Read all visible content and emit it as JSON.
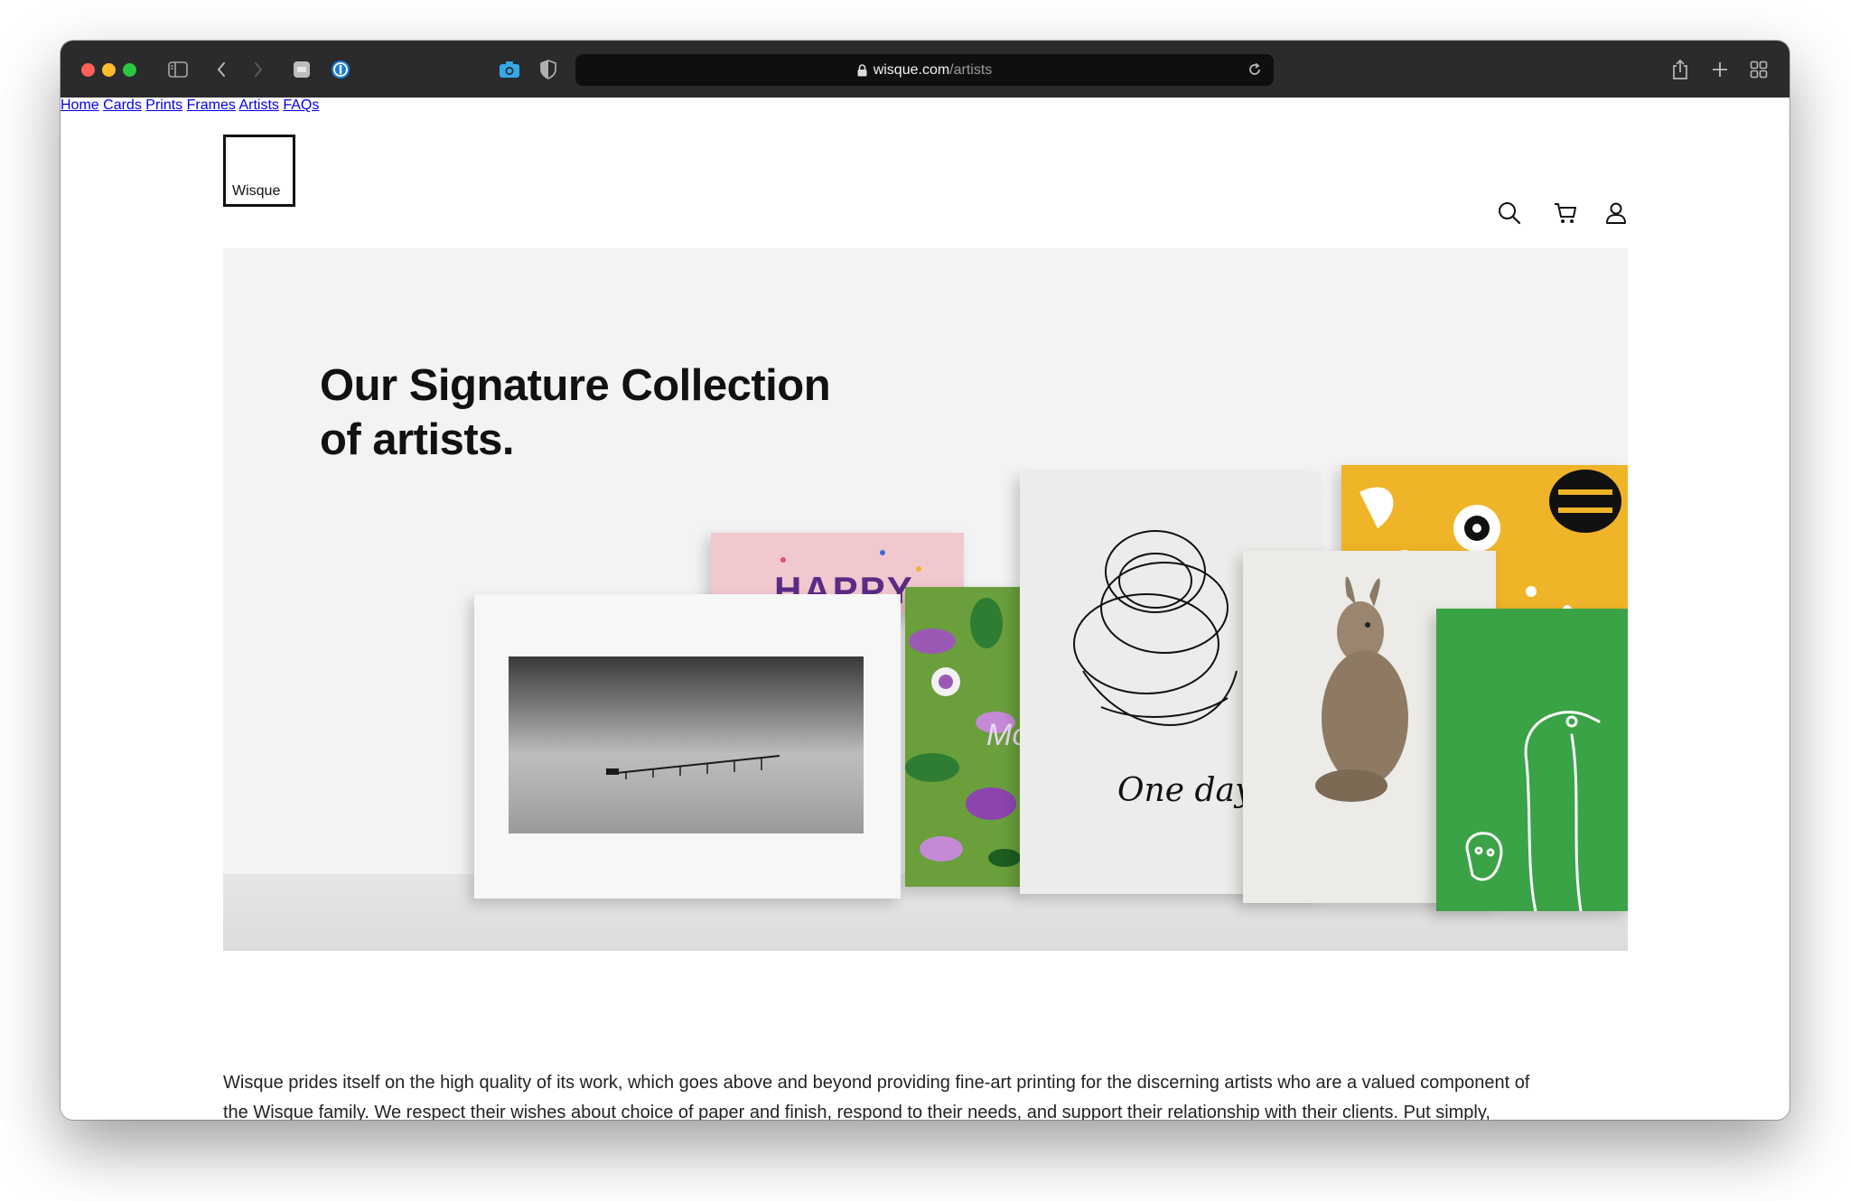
{
  "browser": {
    "url_host": "wisque.com",
    "url_path": "/artists",
    "icons": [
      "sidebar-icon",
      "back-icon",
      "forward-icon",
      "extension-icon",
      "password-manager-icon",
      "camera-icon",
      "shield-icon",
      "lock-icon",
      "reload-icon",
      "share-icon",
      "new-tab-icon",
      "tab-overview-icon"
    ]
  },
  "site": {
    "logo_text": "Wisque",
    "nav": {
      "home": "Home",
      "cards": "Cards",
      "prints": "Prints",
      "frames": "Frames",
      "artists": "Artists",
      "faqs": "FAQs"
    },
    "nav_icons": [
      "search-icon",
      "cart-icon",
      "account-icon"
    ]
  },
  "hero": {
    "title_line1": "Our Signature Collection",
    "title_line2": "of artists.",
    "card_texts": {
      "happy": "HAPPY",
      "one_day": "One day",
      "mo": "Mo"
    }
  },
  "intro": {
    "line1": "Wisque prides itself on the high quality of its work, which goes above and beyond providing fine-art printing for the discerning artists who are a valued component of",
    "line2": "the Wisque family. We respect their wishes about choice of paper and finish, respond to their needs, and support their relationship with their clients. Put simply,"
  },
  "colors": {
    "toolbar": "#2b2a2d",
    "hero_bg": "#f3f3f3",
    "accent_yellow": "#f0b428",
    "accent_green": "#3aa345",
    "text": "#111111"
  }
}
